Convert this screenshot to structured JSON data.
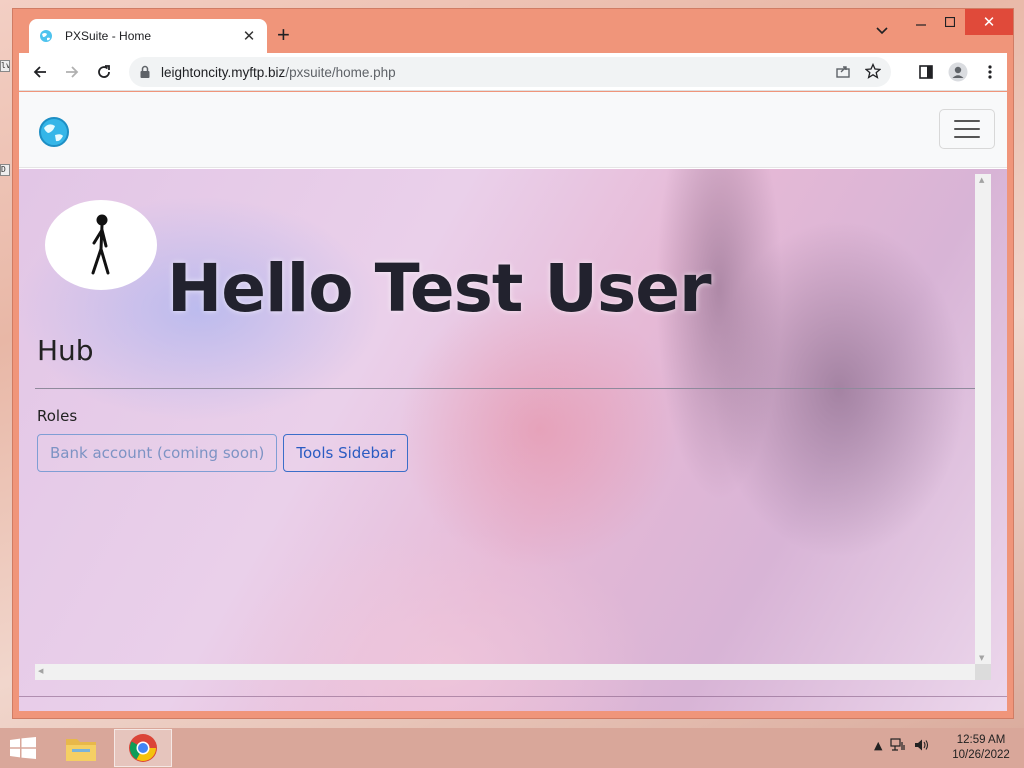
{
  "browser": {
    "tab_title": "PXSuite - Home",
    "url_host": "leightoncity.myftp.biz",
    "url_path": "/pxsuite/home.php"
  },
  "page": {
    "greeting": "Hello Test User",
    "hub_title": "Hub",
    "roles_label": "Roles",
    "buttons": [
      {
        "label": "Bank account (coming soon)",
        "state": "disabled"
      },
      {
        "label": "Tools Sidebar",
        "state": "enabled"
      }
    ]
  },
  "taskbar": {
    "time": "12:59 AM",
    "date": "10/26/2022"
  },
  "desktop_icons": [
    "lv",
    "D"
  ],
  "colors": {
    "window_frame": "#f0957a",
    "accent_blue": "#2a5bc2",
    "close_button": "#e04a3a"
  }
}
